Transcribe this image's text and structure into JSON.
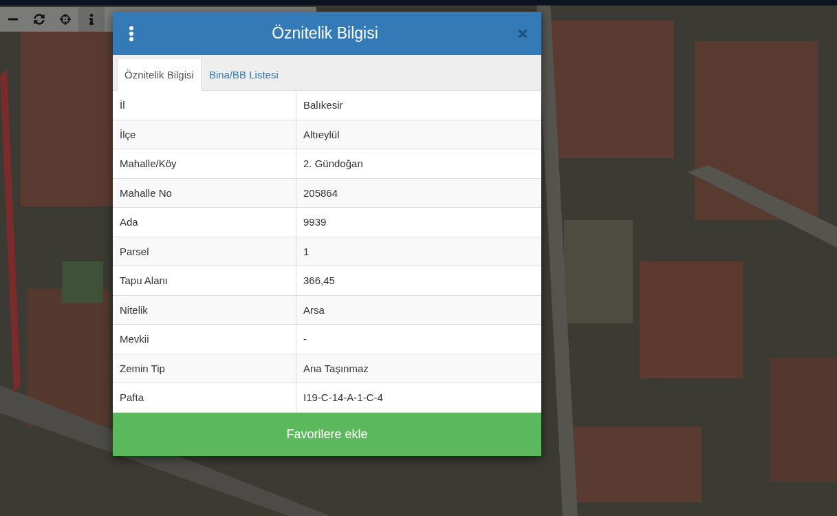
{
  "toolbar": {
    "tools": [
      {
        "kind": "zoom-out",
        "selected": false
      },
      {
        "kind": "refresh",
        "selected": false
      },
      {
        "kind": "locate",
        "selected": false
      },
      {
        "kind": "info",
        "selected": true
      }
    ]
  },
  "dialog": {
    "title": "Öznitelik Bilgisi",
    "tabs": [
      {
        "label": "Öznitelik Bilgisi",
        "selected": true
      },
      {
        "label": "Bina/BB Listesi",
        "selected": false
      }
    ],
    "rows": [
      {
        "label": "İl",
        "value": "Balıkesir"
      },
      {
        "label": "İlçe",
        "value": "Altıeylül"
      },
      {
        "label": "Mahalle/Köy",
        "value": "2. Gündoğan"
      },
      {
        "label": "Mahalle No",
        "value": "205864"
      },
      {
        "label": "Ada",
        "value": "9939"
      },
      {
        "label": "Parsel",
        "value": "1"
      },
      {
        "label": "Tapu Alanı",
        "value": "366,45"
      },
      {
        "label": "Nitelik",
        "value": "Arsa"
      },
      {
        "label": "Mevkii",
        "value": "-"
      },
      {
        "label": "Zemin Tip",
        "value": "Ana Taşınmaz"
      },
      {
        "label": "Pafta",
        "value": "I19-C-14-A-1-C-4"
      }
    ],
    "action": "Favorilere ekle"
  }
}
